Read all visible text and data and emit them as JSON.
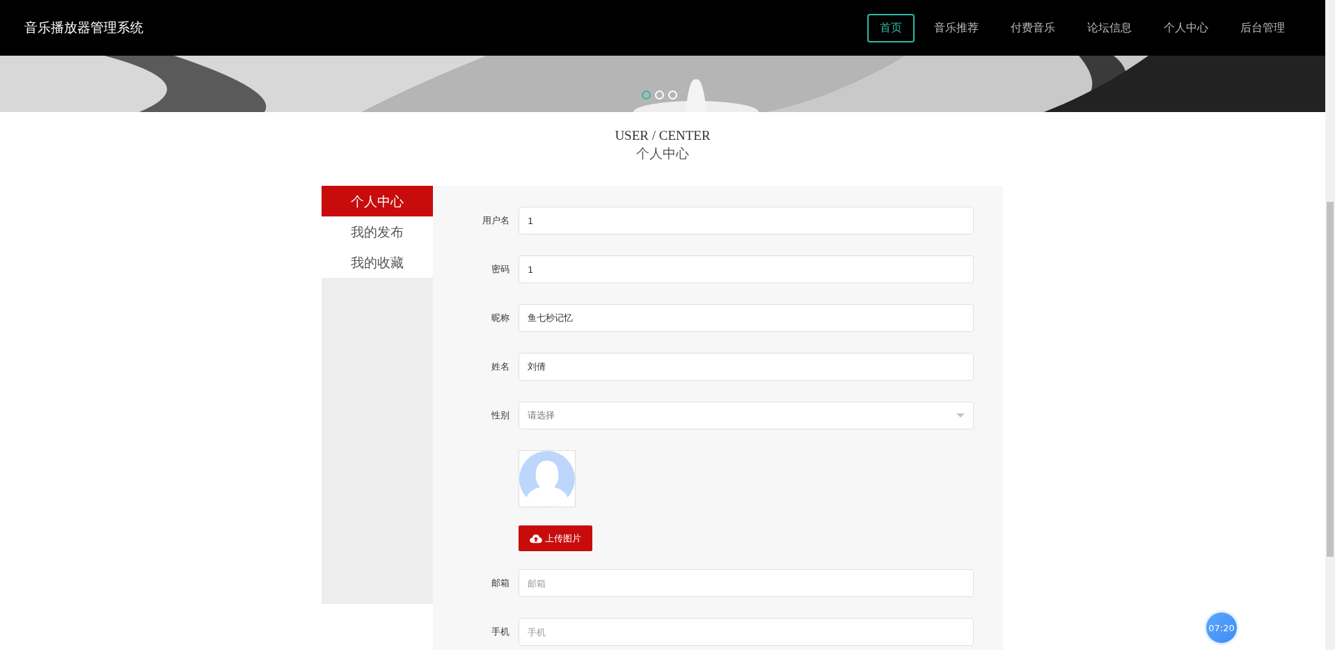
{
  "header": {
    "title": "音乐播放器管理系统",
    "nav": [
      {
        "label": "首页",
        "selected": true
      },
      {
        "label": "音乐推荐",
        "selected": false
      },
      {
        "label": "付费音乐",
        "selected": false
      },
      {
        "label": "论坛信息",
        "selected": false
      },
      {
        "label": "个人中心",
        "selected": false
      },
      {
        "label": "后台管理",
        "selected": false
      }
    ]
  },
  "banner": {
    "kind": "picture",
    "dots": [
      {
        "selected": true
      },
      {
        "selected": false
      },
      {
        "selected": false
      }
    ]
  },
  "heading": {
    "title": "USER / CENTER",
    "subtitle": "个人中心"
  },
  "sidebar": {
    "items": [
      {
        "label": "个人中心",
        "selected": true
      },
      {
        "label": "我的发布",
        "selected": false
      },
      {
        "label": "我的收藏",
        "selected": false
      }
    ]
  },
  "form": {
    "fields": [
      {
        "kind": "input",
        "label": "用户名",
        "value": "1"
      },
      {
        "kind": "input",
        "label": "密码",
        "value": "1"
      },
      {
        "kind": "input",
        "label": "昵称",
        "value": "鱼七秒记忆"
      },
      {
        "kind": "input",
        "label": "姓名",
        "value": "刘倩"
      },
      {
        "kind": "select",
        "label": "性别",
        "placeholder": "请选择"
      },
      {
        "kind": "avatar"
      },
      {
        "kind": "upload",
        "button": "上传图片"
      },
      {
        "kind": "input",
        "label": "邮箱",
        "placeholder": "邮箱"
      },
      {
        "kind": "input",
        "label": "手机",
        "placeholder": "手机"
      }
    ]
  },
  "timer": {
    "time": "07:20"
  }
}
